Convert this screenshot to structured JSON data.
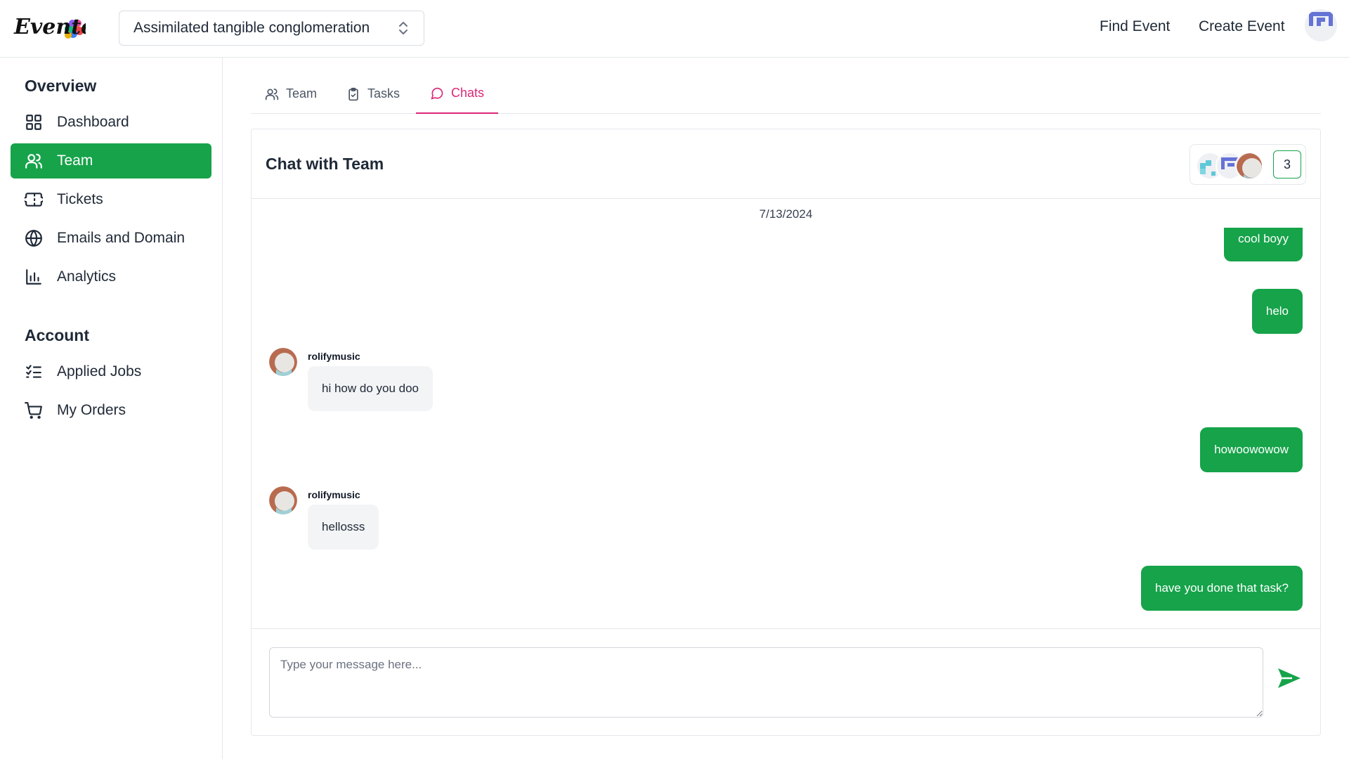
{
  "header": {
    "logo_text": "Evento",
    "org_selector": {
      "value": "Assimilated tangible conglomeration"
    },
    "nav": [
      {
        "label": "Find Event"
      },
      {
        "label": "Create Event"
      }
    ]
  },
  "sidebar": {
    "overview_heading": "Overview",
    "overview_items": [
      {
        "label": "Dashboard",
        "icon": "grid-icon"
      },
      {
        "label": "Team",
        "icon": "users-icon",
        "active": true
      },
      {
        "label": "Tickets",
        "icon": "ticket-icon"
      },
      {
        "label": "Emails and Domain",
        "icon": "globe-icon"
      },
      {
        "label": "Analytics",
        "icon": "bar-chart-icon"
      }
    ],
    "account_heading": "Account",
    "account_items": [
      {
        "label": "Applied Jobs",
        "icon": "list-checks-icon"
      },
      {
        "label": "My Orders",
        "icon": "cart-icon"
      }
    ]
  },
  "tabs": [
    {
      "label": "Team",
      "icon": "users-icon"
    },
    {
      "label": "Tasks",
      "icon": "clipboard-check-icon"
    },
    {
      "label": "Chats",
      "icon": "message-circle-icon",
      "active": true
    }
  ],
  "chat": {
    "title": "Chat with Team",
    "member_count": "3",
    "date": "7/13/2024",
    "messages": [
      {
        "from": "me",
        "text": "cool boyy"
      },
      {
        "from": "me",
        "text": "helo"
      },
      {
        "from": "rolifymusic",
        "sender": "rolifymusic",
        "text": "hi how do you doo"
      },
      {
        "from": "me",
        "text": "howoowowow"
      },
      {
        "from": "rolifymusic",
        "sender": "rolifymusic",
        "text": "hellosss"
      },
      {
        "from": "me",
        "text": "have you done that task?"
      }
    ],
    "composer": {
      "placeholder": "Type your message here...",
      "value": ""
    }
  },
  "colors": {
    "accent_green": "#16a34a",
    "active_tab_pink": "#db2777",
    "incoming_bubble": "#f3f4f6"
  }
}
